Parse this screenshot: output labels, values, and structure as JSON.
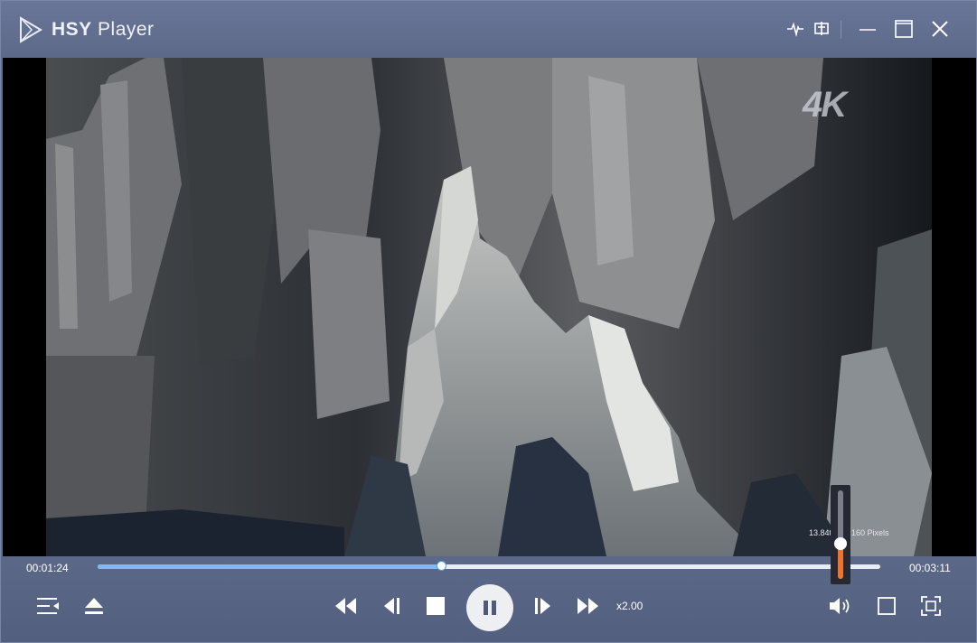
{
  "app": {
    "title_bold": "HSY",
    "title_rest": " Player"
  },
  "titlebar_icons": [
    "waveform-icon",
    "subtitle-icon",
    "minimize-icon",
    "maximize-icon",
    "close-icon"
  ],
  "video": {
    "badge": "4K",
    "overlay_left": "13.84t",
    "overlay_right": "160 Pixels"
  },
  "playback": {
    "current_time": "00:01:24",
    "total_time": "00:03:11",
    "progress": 0.44,
    "speed": "x2.00",
    "volume": 0.4
  },
  "controls": {
    "left": [
      "playlist-icon",
      "eject-icon"
    ],
    "center": [
      "rewind-icon",
      "previous-frame-icon",
      "stop-icon",
      "pause-icon",
      "next-frame-icon",
      "fast-forward-icon"
    ],
    "right": [
      "volume-icon",
      "window-mode-icon",
      "fullscreen-icon"
    ]
  },
  "colors": {
    "accent": "#79bdf0",
    "volume": "#f0722b",
    "chrome": "#5f6b8c"
  }
}
